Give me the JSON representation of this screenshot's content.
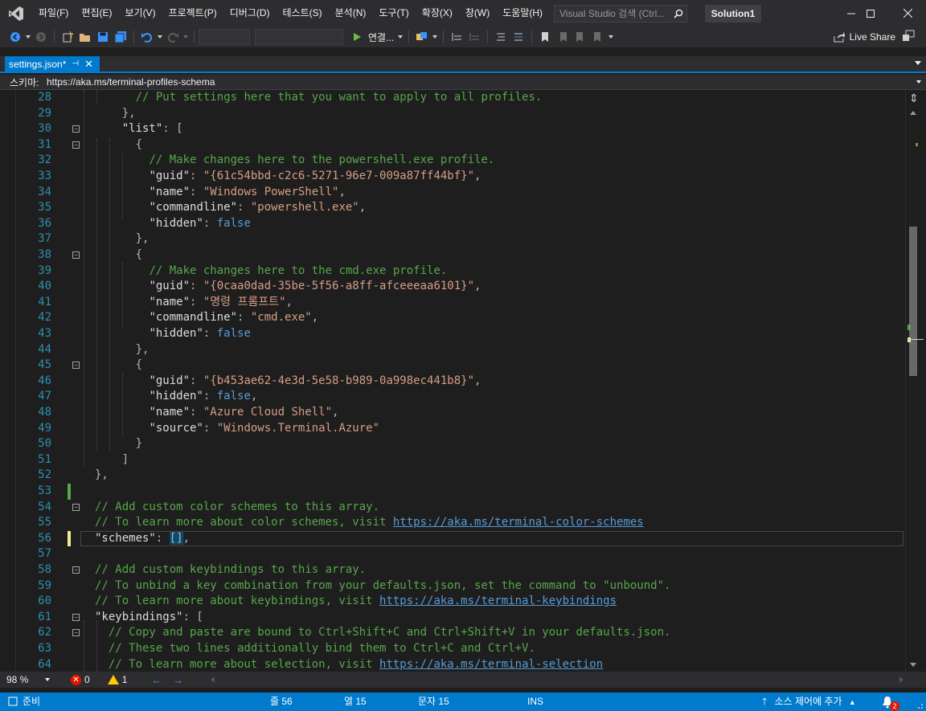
{
  "menubar": {
    "items": [
      "파일(F)",
      "편집(E)",
      "보기(V)",
      "프로젝트(P)",
      "디버그(D)",
      "테스트(S)",
      "분석(N)",
      "도구(T)",
      "확장(X)",
      "창(W)",
      "도움말(H)"
    ],
    "search_placeholder": "Visual Studio 검색 (Ctrl...",
    "solution_name": "Solution1"
  },
  "toolbar": {
    "run_label": "연결...",
    "live_share_label": "Live Share"
  },
  "tab": {
    "title": "settings.json*"
  },
  "schema": {
    "label": "스키마:",
    "url": "https://aka.ms/terminal-profiles-schema"
  },
  "editor": {
    "lines": [
      {
        "n": "28",
        "html": "<span class=\"c-com\">// Put settings here that you want to apply to all profiles.</span>"
      },
      {
        "n": "29",
        "html": "<span class=\"c-punc\">},</span>"
      },
      {
        "n": "30",
        "html": "<span class=\"c-key\">\"list\"</span><span class=\"c-punc\">: [</span>"
      },
      {
        "n": "31",
        "html": "<span class=\"c-punc\">{</span>"
      },
      {
        "n": "32",
        "html": "<span class=\"c-com\">// Make changes here to the powershell.exe profile.</span>"
      },
      {
        "n": "33",
        "html": "<span class=\"c-key\">\"guid\"</span><span class=\"c-punc\">: </span><span class=\"c-str\">\"{61c54bbd-c2c6-5271-96e7-009a87ff44bf}\"</span><span class=\"c-punc\">,</span>"
      },
      {
        "n": "34",
        "html": "<span class=\"c-key\">\"name\"</span><span class=\"c-punc\">: </span><span class=\"c-str\">\"Windows PowerShell\"</span><span class=\"c-punc\">,</span>"
      },
      {
        "n": "35",
        "html": "<span class=\"c-key\">\"commandline\"</span><span class=\"c-punc\">: </span><span class=\"c-str\">\"powershell.exe\"</span><span class=\"c-punc\">,</span>"
      },
      {
        "n": "36",
        "html": "<span class=\"c-key\">\"hidden\"</span><span class=\"c-punc\">: </span><span class=\"c-kw\">false</span>"
      },
      {
        "n": "37",
        "html": "<span class=\"c-punc\">},</span>"
      },
      {
        "n": "38",
        "html": "<span class=\"c-punc\">{</span>"
      },
      {
        "n": "39",
        "html": "<span class=\"c-com\">// Make changes here to the cmd.exe profile.</span>"
      },
      {
        "n": "40",
        "html": "<span class=\"c-key\">\"guid\"</span><span class=\"c-punc\">: </span><span class=\"c-str\">\"{0caa0dad-35be-5f56-a8ff-afceeeaa6101}\"</span><span class=\"c-punc\">,</span>"
      },
      {
        "n": "41",
        "html": "<span class=\"c-key\">\"name\"</span><span class=\"c-punc\">: </span><span class=\"c-str\">\"명령 프롬프트\"</span><span class=\"c-punc\">,</span>"
      },
      {
        "n": "42",
        "html": "<span class=\"c-key\">\"commandline\"</span><span class=\"c-punc\">: </span><span class=\"c-str\">\"cmd.exe\"</span><span class=\"c-punc\">,</span>"
      },
      {
        "n": "43",
        "html": "<span class=\"c-key\">\"hidden\"</span><span class=\"c-punc\">: </span><span class=\"c-kw\">false</span>"
      },
      {
        "n": "44",
        "html": "<span class=\"c-punc\">},</span>"
      },
      {
        "n": "45",
        "html": "<span class=\"c-punc\">{</span>"
      },
      {
        "n": "46",
        "html": "<span class=\"c-key\">\"guid\"</span><span class=\"c-punc\">: </span><span class=\"c-str\">\"{b453ae62-4e3d-5e58-b989-0a998ec441b8}\"</span><span class=\"c-punc\">,</span>"
      },
      {
        "n": "47",
        "html": "<span class=\"c-key\">\"hidden\"</span><span class=\"c-punc\">: </span><span class=\"c-kw\">false</span><span class=\"c-punc\">,</span>"
      },
      {
        "n": "48",
        "html": "<span class=\"c-key\">\"name\"</span><span class=\"c-punc\">: </span><span class=\"c-str\">\"Azure Cloud Shell\"</span><span class=\"c-punc\">,</span>"
      },
      {
        "n": "49",
        "html": "<span class=\"c-key\">\"source\"</span><span class=\"c-punc\">: </span><span class=\"c-str\">\"Windows.Terminal.Azure\"</span>"
      },
      {
        "n": "50",
        "html": "<span class=\"c-punc\">}</span>"
      },
      {
        "n": "51",
        "html": "<span class=\"c-punc\">]</span>"
      },
      {
        "n": "52",
        "html": "<span class=\"c-punc\">},</span>"
      },
      {
        "n": "53",
        "html": ""
      },
      {
        "n": "54",
        "html": "<span class=\"c-com\">// Add custom color schemes to this array.</span>"
      },
      {
        "n": "55",
        "html": "<span class=\"c-com\">// To learn more about color schemes, visit </span><span class=\"c-url\">https://aka.ms/terminal-color-schemes</span>"
      },
      {
        "n": "56",
        "html": "<span class=\"c-key\">\"schemes\"</span><span class=\"c-punc\">: </span><span class=\"c-punc\" style=\"background:#0e4a6e\">[]</span><span class=\"c-punc\">,</span>"
      },
      {
        "n": "57",
        "html": ""
      },
      {
        "n": "58",
        "html": "<span class=\"c-com\">// Add custom keybindings to this array.</span>"
      },
      {
        "n": "59",
        "html": "<span class=\"c-com\">// To unbind a key combination from your defaults.json, set the command to \"unbound\".</span>"
      },
      {
        "n": "60",
        "html": "<span class=\"c-com\">// To learn more about keybindings, visit </span><span class=\"c-url\">https://aka.ms/terminal-keybindings</span>"
      },
      {
        "n": "61",
        "html": "<span class=\"c-key\">\"keybindings\"</span><span class=\"c-punc\">: [</span>"
      },
      {
        "n": "62",
        "html": "<span class=\"c-com\">// Copy and paste are bound to Ctrl+Shift+C and Ctrl+Shift+V in your defaults.json.</span>"
      },
      {
        "n": "63",
        "html": "<span class=\"c-com\">// These two lines additionally bind them to Ctrl+C and Ctrl+V.</span>"
      },
      {
        "n": "64",
        "html": "<span class=\"c-com\">// To learn more about selection, visit </span><span class=\"c-url\">https://aka.ms/terminal-selection</span>"
      }
    ]
  },
  "bottom": {
    "zoom": "98 %",
    "errors": "0",
    "warnings": "1"
  },
  "status": {
    "ready": "준비",
    "line": "줄 56",
    "col": "열 15",
    "char": "문자 15",
    "mode": "INS",
    "source_control": "소스 제어에 추가",
    "notifications": "2"
  },
  "colors": {
    "accent": "#007acc",
    "background": "#1e1e1e",
    "chrome": "#2d2d30"
  }
}
